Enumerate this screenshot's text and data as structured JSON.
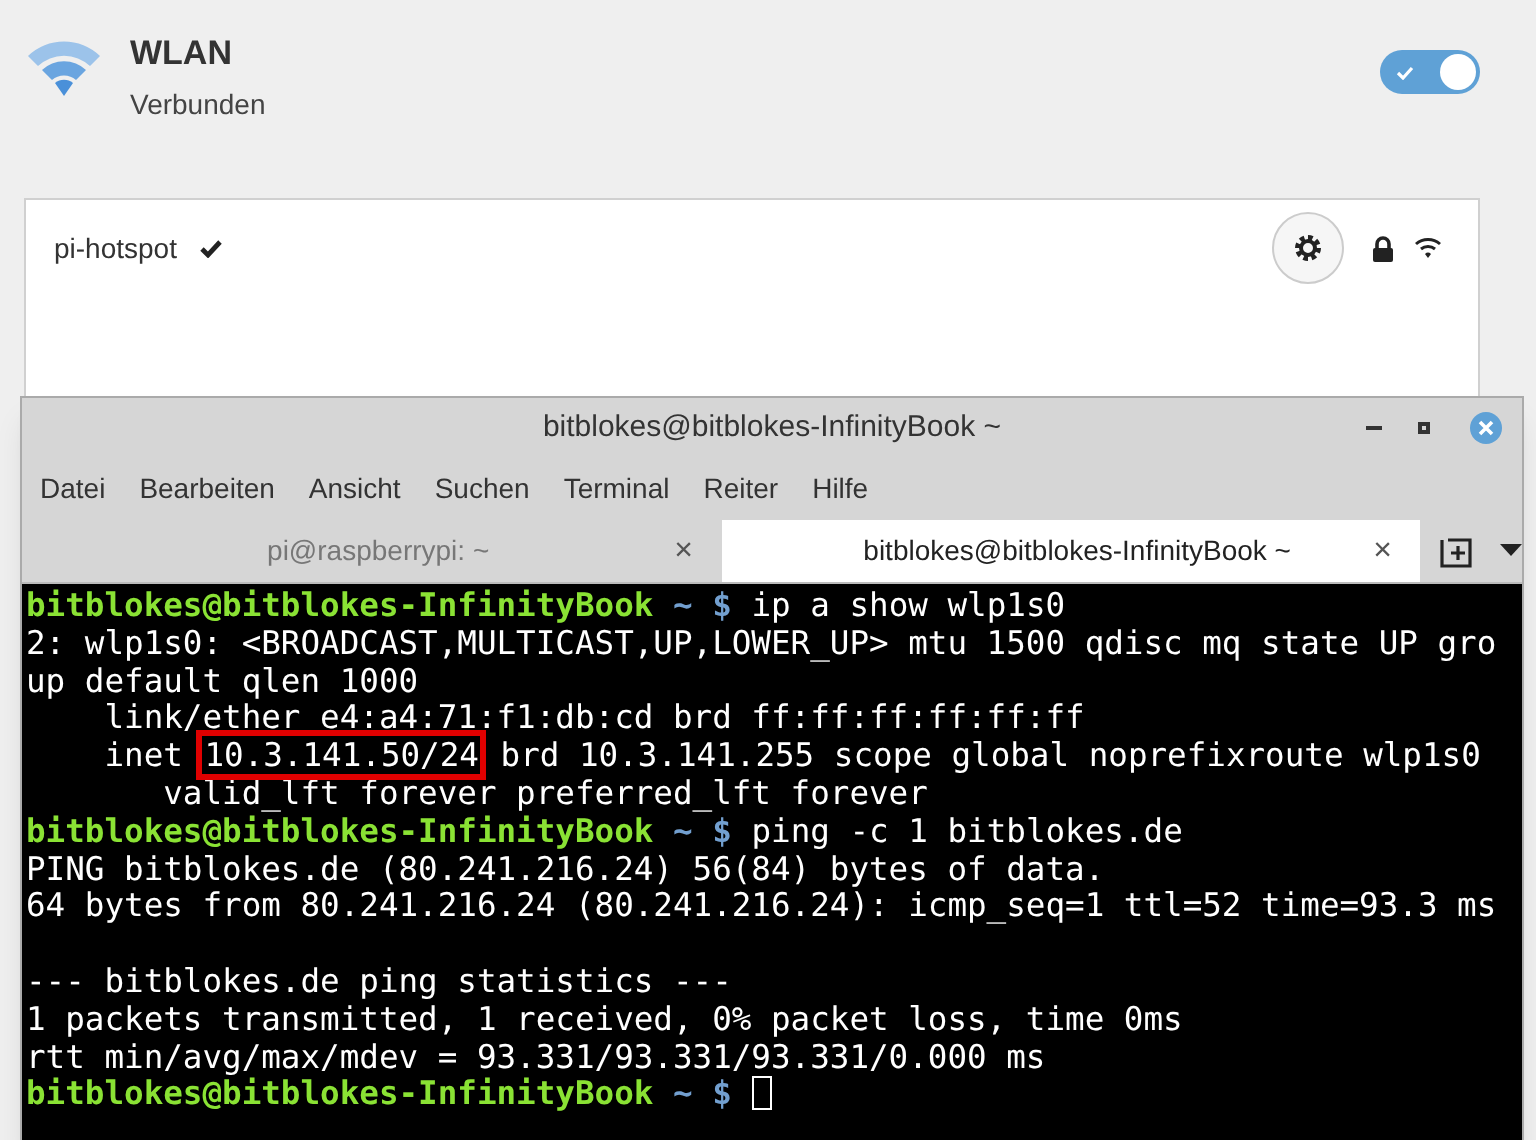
{
  "wlan": {
    "title": "WLAN",
    "status": "Verbunden",
    "enabled": true
  },
  "networks": [
    {
      "name": "pi-hotspot",
      "connected": true,
      "secured": true
    }
  ],
  "terminal": {
    "title": "bitblokes@bitblokes-InfinityBook ~",
    "menu": [
      "Datei",
      "Bearbeiten",
      "Ansicht",
      "Suchen",
      "Terminal",
      "Reiter",
      "Hilfe"
    ],
    "tabs": [
      {
        "label": "pi@raspberrypi: ~",
        "selected": false,
        "close": "×"
      },
      {
        "label": "bitblokes@bitblokes-InfinityBook ~",
        "selected": true,
        "close": "×"
      }
    ],
    "lines": [
      {
        "kind": "prompt",
        "user": "bitblokes@bitblokes-InfinityBook",
        "path": "~ $",
        "command": "ip a show wlp1s0",
        "cursor": false
      },
      {
        "kind": "output",
        "text": "2: wlp1s0: <BROADCAST,MULTICAST,UP,LOWER_UP> mtu 1500 qdisc mq state UP gro"
      },
      {
        "kind": "output",
        "text": "up default qlen 1000"
      },
      {
        "kind": "output",
        "text": "    link/ether e4:a4:71:f1:db:cd brd ff:ff:ff:ff:ff:ff"
      },
      {
        "kind": "highlight",
        "before": "    inet ",
        "highlight": "10.3.141.50/24",
        "after": " brd 10.3.141.255 scope global noprefixroute wlp1s0"
      },
      {
        "kind": "output",
        "text": "       valid_lft forever preferred_lft forever"
      },
      {
        "kind": "prompt",
        "user": "bitblokes@bitblokes-InfinityBook",
        "path": "~ $",
        "command": "ping -c 1 bitblokes.de",
        "cursor": false
      },
      {
        "kind": "output",
        "text": "PING bitblokes.de (80.241.216.24) 56(84) bytes of data."
      },
      {
        "kind": "output",
        "text": "64 bytes from 80.241.216.24 (80.241.216.24): icmp_seq=1 ttl=52 time=93.3 ms"
      },
      {
        "kind": "blank"
      },
      {
        "kind": "output",
        "text": "--- bitblokes.de ping statistics ---"
      },
      {
        "kind": "output",
        "text": "1 packets transmitted, 1 received, 0% packet loss, time 0ms"
      },
      {
        "kind": "output",
        "text": "rtt min/avg/max/mdev = 93.331/93.331/93.331/0.000 ms"
      },
      {
        "kind": "prompt",
        "user": "bitblokes@bitblokes-InfinityBook",
        "path": "~ $",
        "cursor": true
      }
    ]
  }
}
